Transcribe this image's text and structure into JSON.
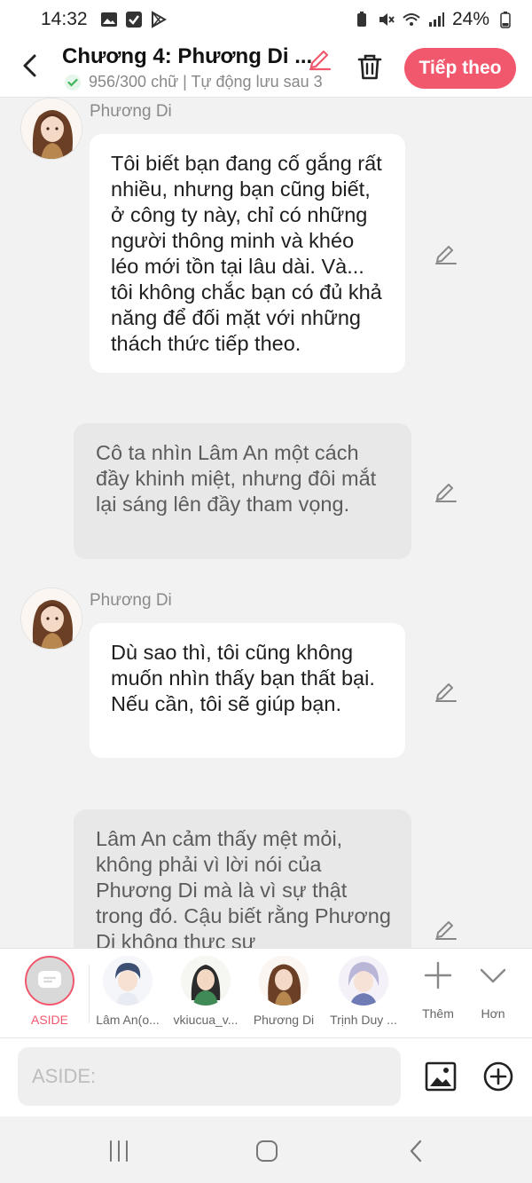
{
  "status_bar": {
    "time": "14:32",
    "battery": "24%",
    "left_icons": [
      "gallery-icon",
      "checkbox-icon",
      "play-store-icon"
    ],
    "right_icons": [
      "battery-saver-icon",
      "mute-icon",
      "wifi-icon",
      "signal-icon",
      "battery-icon"
    ]
  },
  "header": {
    "title": "Chương 4: Phương Di ...",
    "subtitle": "956/300 chữ | Tự động lưu sau 3",
    "next_label": "Tiếp theo"
  },
  "messages": [
    {
      "type": "dialog",
      "speaker": "Phương Di",
      "text": "Tôi biết bạn đang cố gắng rất nhiều, nhưng bạn cũng biết, ở công ty này, chỉ có những người thông minh và khéo léo mới tồn tại lâu dài. Và... tôi không chắc bạn có đủ khả năng để đối mặt với những thách thức tiếp theo."
    },
    {
      "type": "aside",
      "text": "Cô ta nhìn Lâm An một cách đầy khinh miệt, nhưng đôi mắt lại sáng lên đầy tham vọng."
    },
    {
      "type": "dialog",
      "speaker": "Phương Di",
      "text": "Dù sao thì, tôi cũng không muốn nhìn thấy bạn thất bại. Nếu cần, tôi sẽ giúp bạn."
    },
    {
      "type": "aside",
      "text": "Lâm An cảm thấy mệt mỏi, không phải vì lời nói của Phương Di mà là vì sự thật trong đó. Cậu biết rằng Phương Di không thực sự"
    }
  ],
  "characters": [
    {
      "name": "ASIDE",
      "selected": true
    },
    {
      "name": "Lâm An(o..."
    },
    {
      "name": "vkiucua_v..."
    },
    {
      "name": "Phương Di"
    },
    {
      "name": "Trịnh Duy ..."
    }
  ],
  "tools": {
    "more_label": "Thêm",
    "collapse_label": "Hơn"
  },
  "input": {
    "placeholder": "ASIDE:",
    "value": ""
  },
  "colors": {
    "accent": "#f2586d",
    "aside_bubble": "#e8e8e8",
    "dialog_bubble": "#ffffff",
    "background": "#f2f2f2"
  }
}
